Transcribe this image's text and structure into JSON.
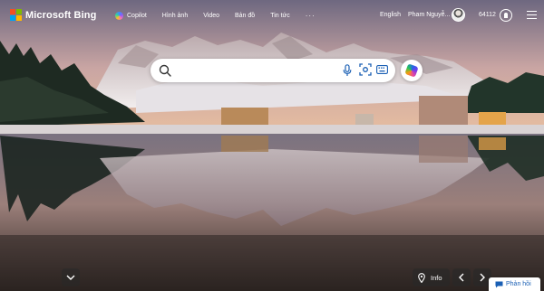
{
  "brand": {
    "name": "Microsoft Bing",
    "logo_colors": [
      "#f25022",
      "#7fba00",
      "#00a4ef",
      "#ffb900"
    ]
  },
  "nav": {
    "items": [
      {
        "label": "Copilot",
        "icon": "copilot-icon"
      },
      {
        "label": "Hình ảnh"
      },
      {
        "label": "Video"
      },
      {
        "label": "Bản đồ"
      },
      {
        "label": "Tin tức"
      }
    ],
    "more_label": "···"
  },
  "header_right": {
    "language": "English",
    "user_name": "Pham Nguyễ...",
    "reward_points": "64112",
    "reward_icon": "rewards-medal-icon",
    "menu_icon": "hamburger-menu-icon"
  },
  "search": {
    "value": "",
    "placeholder": "",
    "icons": [
      "search-icon",
      "microphone-icon",
      "visual-search-icon",
      "keyboard-icon",
      "copilot-icon"
    ]
  },
  "bottom": {
    "scroll_down_icon": "chevron-down-icon",
    "info_label": "Info",
    "info_icon": "location-pin-icon",
    "prev_icon": "chevron-left-icon",
    "next_icon": "chevron-right-icon",
    "feedback_label": "Phản hồi",
    "feedback_icon": "chat-feedback-icon"
  }
}
